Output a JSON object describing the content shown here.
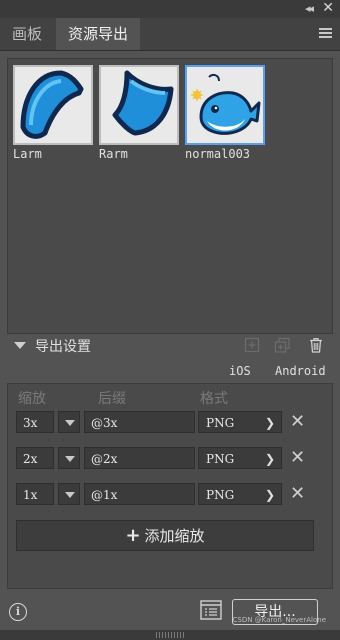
{
  "window": {
    "collapse_icon": "double-chevron-left-icon",
    "close_icon": "close-icon"
  },
  "tabs": [
    {
      "label": "画板",
      "active": false
    },
    {
      "label": "资源导出",
      "active": true
    }
  ],
  "assets": [
    {
      "name": "Larm",
      "icon": "blue-fin-asset",
      "selected": false
    },
    {
      "name": "Rarm",
      "icon": "blue-fin-asset",
      "selected": false
    },
    {
      "name": "normal003",
      "icon": "whale-asset",
      "selected": true
    }
  ],
  "export_settings": {
    "title": "导出设置",
    "platforms": [
      "iOS",
      "Android"
    ],
    "columns": {
      "scale": "缩放",
      "suffix": "后缀",
      "format": "格式"
    },
    "rows": [
      {
        "scale": "3x",
        "suffix": "@3x",
        "format": "PNG"
      },
      {
        "scale": "2x",
        "suffix": "@2x",
        "format": "PNG"
      },
      {
        "scale": "1x",
        "suffix": "@1x",
        "format": "PNG"
      }
    ],
    "add_scale_label": "添加缩放"
  },
  "bottom": {
    "export_label": "导出..."
  },
  "watermark": "CSDN @Karon_NeverAlone",
  "colors": {
    "accent": "#5aa0f0",
    "fin_blue": "#1e8fd8",
    "outline": "#0f2850",
    "panel": "#535353"
  }
}
